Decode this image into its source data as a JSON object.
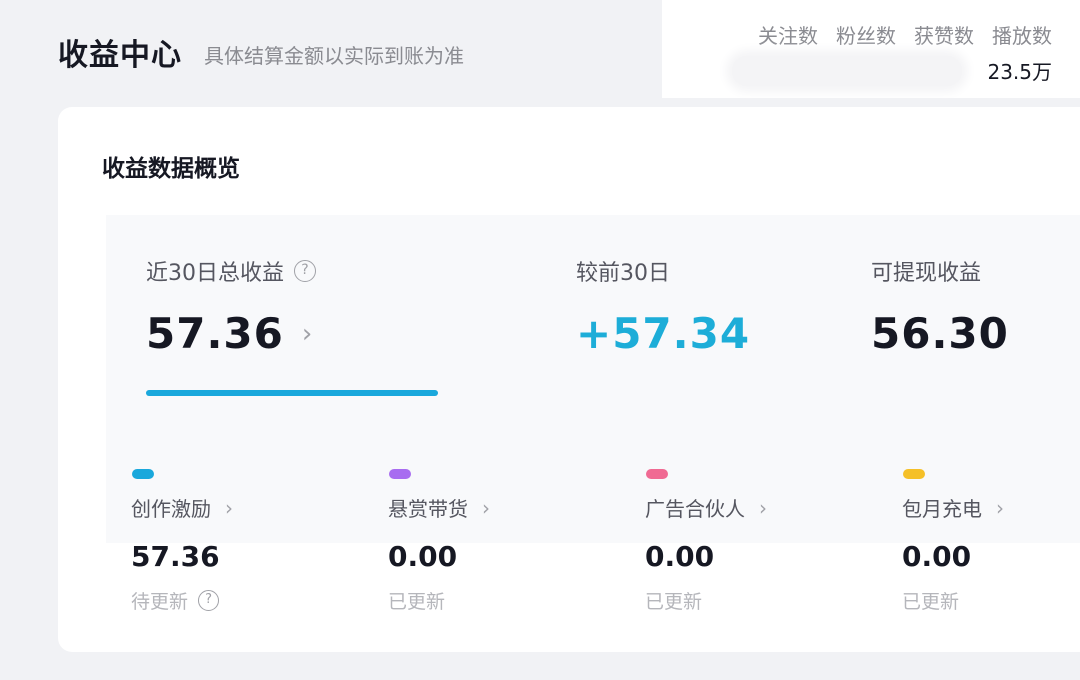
{
  "header": {
    "title": "收益中心",
    "subtitle": "具体结算金额以实际到账为准"
  },
  "stats": {
    "labels": [
      "关注数",
      "粉丝数",
      "获赞数",
      "播放数"
    ],
    "play_count": "23.5万"
  },
  "overview": {
    "title": "收益数据概览",
    "total_30d": {
      "label": "近30日总收益",
      "value": "57.36"
    },
    "vs_prev": {
      "label": "较前30日",
      "value": "+57.34"
    },
    "withdrawable": {
      "label": "可提现收益",
      "value": "56.30"
    },
    "progress_fraction": 1.0
  },
  "categories": [
    {
      "name": "创作激励",
      "value": "57.36",
      "status": "待更新",
      "color": "#1aa8dc"
    },
    {
      "name": "悬赏带货",
      "value": "0.00",
      "status": "已更新",
      "color": "#a86cf0"
    },
    {
      "name": "广告合伙人",
      "value": "0.00",
      "status": "已更新",
      "color": "#f06a93"
    },
    {
      "name": "包月充电",
      "value": "0.00",
      "status": "已更新",
      "color": "#f5c028"
    }
  ],
  "colors": {
    "accent": "#1aa8dc",
    "positive": "#1dadd8"
  },
  "icons": {
    "help": "question-circle-icon",
    "chevron": "chevron-right-icon"
  }
}
